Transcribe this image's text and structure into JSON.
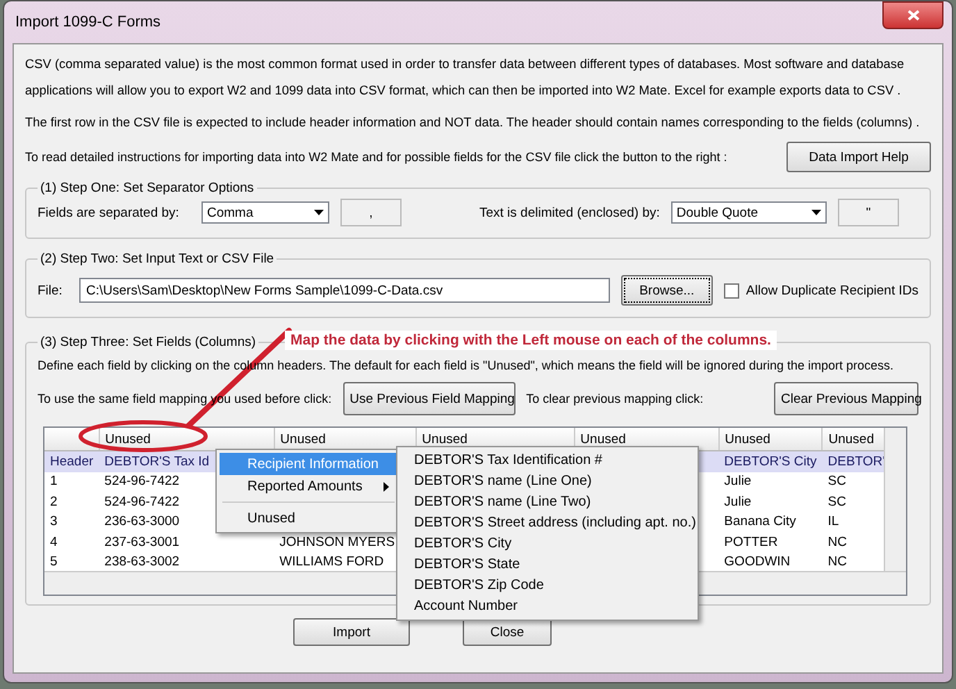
{
  "window": {
    "title": "Import 1099-C Forms"
  },
  "intro": [
    "CSV (comma separated value) is the most common format used in order to transfer data between different types of databases.  Most software and database applications will allow you to export W2 and 1099 data into CSV format, which can then be imported into W2 Mate. Excel for example exports data to CSV .",
    "The first row in the CSV file is expected to include header information and NOT data. The header should contain names corresponding to the fields (columns) ."
  ],
  "help_prompt": "To read detailed instructions for importing data into W2 Mate and for possible fields for the CSV file click the button to the right :",
  "help_button": "Data Import Help",
  "step_one": {
    "legend": "(1)  Step One: Set Separator Options",
    "fields_label": "Fields are separated by:",
    "fields_value": "Comma",
    "fields_char": ",",
    "text_label": "Text is delimited (enclosed) by:",
    "text_value": "Double Quote",
    "text_char": "\""
  },
  "step_two": {
    "legend": "(2)  Step Two: Set Input Text or CSV File",
    "file_label": "File:",
    "file_value": "C:\\Users\\Sam\\Desktop\\New Forms Sample\\1099-C-Data.csv",
    "browse_button": "Browse...",
    "allow_duplicates": {
      "label": "Allow Duplicate Recipient IDs",
      "checked": false
    }
  },
  "annotation": "Map the data by clicking with the Left mouse on each of the columns.",
  "step_three": {
    "legend": "(3)  Step Three: Set Fields (Columns)",
    "description": "Define each field by clicking on the column headers. The default for each field is \"Unused\", which means the field will be ignored during the import process.",
    "same_prompt": "To use the same field mapping you used before click:",
    "same_button": "Use Previous Field Mapping",
    "clear_prompt": "To clear previous mapping click:",
    "clear_button": "Clear Previous Mapping",
    "grid": {
      "columns": [
        "Unused",
        "Unused",
        "Unused",
        "Unused",
        "Unused",
        "Unused"
      ],
      "rows": [
        {
          "label": "Header",
          "selected": true,
          "cells": {
            "col_1": "DEBTOR'S Tax Id",
            "col_5": "DEBTOR'S City",
            "col_6": "DEBTOR'"
          }
        },
        {
          "label": "1",
          "selected": false,
          "cells": {
            "col_1": "524-96-7422",
            "col_5": "Julie",
            "col_6": "SC"
          }
        },
        {
          "label": "2",
          "selected": false,
          "cells": {
            "col_1": "524-96-7422",
            "col_5": "Julie",
            "col_6": "SC"
          }
        },
        {
          "label": "3",
          "selected": false,
          "cells": {
            "col_1": "236-63-3000",
            "col_5": "Banana City",
            "col_6": "IL"
          }
        },
        {
          "label": "4",
          "selected": false,
          "cells": {
            "col_1": "237-63-3001",
            "col_2": "JOHNSON MYERS",
            "col_5": "POTTER",
            "col_6": "NC"
          }
        },
        {
          "label": "5",
          "selected": false,
          "cells": {
            "col_1": "238-63-3002",
            "col_2": "WILLIAMS FORD",
            "col_5": "GOODWIN",
            "col_6": "NC"
          }
        }
      ]
    }
  },
  "context_menu": {
    "items": [
      {
        "kind": "submenu",
        "label": "Recipient Information",
        "selected": true
      },
      {
        "kind": "submenu",
        "label": "Reported Amounts",
        "selected": false
      },
      {
        "kind": "separator"
      },
      {
        "kind": "item",
        "label": "Unused",
        "selected": false
      }
    ]
  },
  "submenu": {
    "items": [
      "DEBTOR'S Tax Identification #",
      "DEBTOR'S name (Line One)",
      "DEBTOR'S name (Line Two)",
      "DEBTOR'S Street address (including apt. no.)",
      "DEBTOR'S City",
      "DEBTOR'S State",
      "DEBTOR'S Zip Code",
      "Account Number"
    ]
  },
  "buttons": [
    "Import",
    "Close"
  ]
}
